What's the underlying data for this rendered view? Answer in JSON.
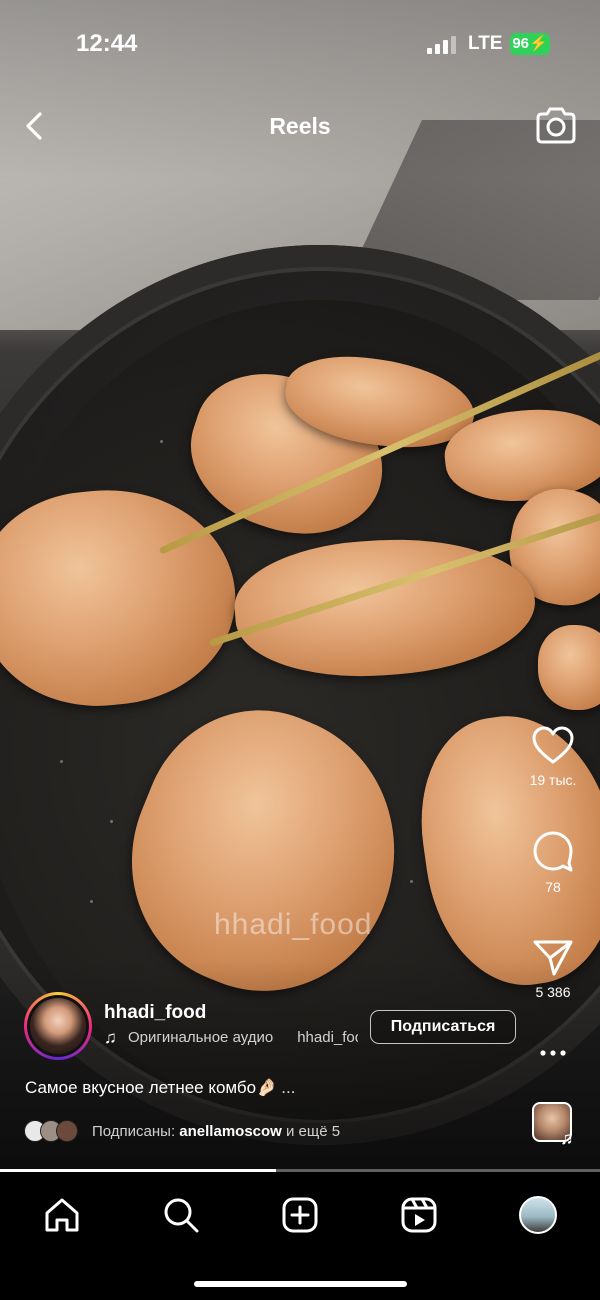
{
  "status_bar": {
    "time": "12:44",
    "network": "LTE",
    "battery": "96"
  },
  "header": {
    "title": "Reels"
  },
  "video": {
    "watermark": "hhadi_food",
    "progress": 0.46
  },
  "actions": {
    "likes": "19 тыс.",
    "comments": "78",
    "shares": "5 386"
  },
  "author": {
    "username": "hhadi_food",
    "audio_label": "Оригинальное аудио",
    "audio_author": "hhadi_food",
    "follow_label": "Подписаться"
  },
  "caption": {
    "text": "Самое вкусное летнее комбо🤌🏻",
    "more": "..."
  },
  "followed_by": {
    "prefix": "Подписаны:",
    "name": "anellamoscow",
    "suffix": "и ещё 5"
  },
  "icons": {
    "back": "chevron-left-icon",
    "camera": "camera-icon",
    "like": "heart-icon",
    "comment": "comment-bubble-icon",
    "share": "paper-plane-icon",
    "more": "more-dots-icon",
    "home": "home-icon",
    "search": "search-icon",
    "create": "plus-square-icon",
    "reels": "reels-icon",
    "profile": "profile-avatar"
  },
  "colors": {
    "battery": "#30d158",
    "background": "#000000",
    "text": "#ffffff"
  }
}
